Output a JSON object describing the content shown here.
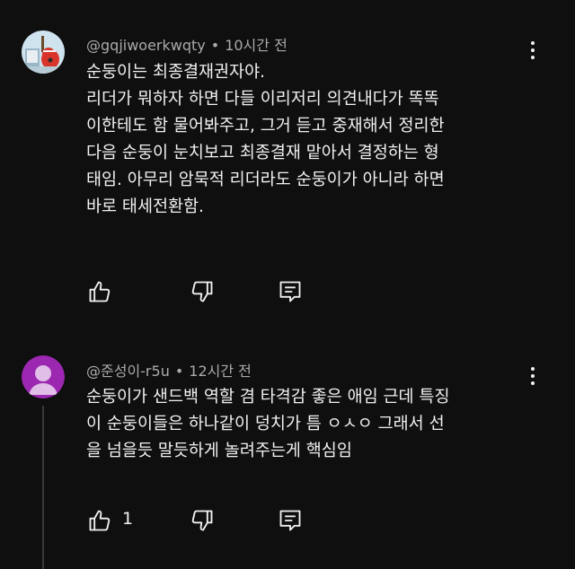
{
  "comments": [
    {
      "author": "@gqjiwoerkwqty",
      "separator": "•",
      "time": "10시간 전",
      "avatar_icon": "guitar-avatar-icon",
      "lines": [
        "순둥이는 최종결재권자야.",
        "리더가 뭐하자 하면 다들 이리저리 의견내다가 똑똑",
        "이한테도 함 물어봐주고, 그거 듣고 중재해서 정리한",
        "다음 순둥이 눈치보고 최종결재 맡아서 결정하는 형",
        "태임. 아무리 암묵적 리더라도 순둥이가 아니라 하면",
        "바로 태세전환함."
      ],
      "like_count": "",
      "icons": {
        "like": "thumbs-up-icon",
        "dislike": "thumbs-down-icon",
        "reply": "reply-icon",
        "more": "more-vert-icon"
      }
    },
    {
      "author": "@준성이-r5u",
      "separator": "•",
      "time": "12시간 전",
      "avatar_icon": "default-user-avatar-icon",
      "avatar_color": "#9c27b0",
      "lines": [
        "순둥이가 샌드백 역할 겸 타격감 좋은 애임 근데 특징",
        "이 순둥이들은 하나같이 덩치가 틈 ㅇㅅㅇ 그래서 선",
        "을 넘을듯 말듯하게 놀려주는게 핵심임"
      ],
      "like_count": "1",
      "icons": {
        "like": "thumbs-up-icon",
        "dislike": "thumbs-down-icon",
        "reply": "reply-icon",
        "more": "more-vert-icon"
      }
    }
  ]
}
